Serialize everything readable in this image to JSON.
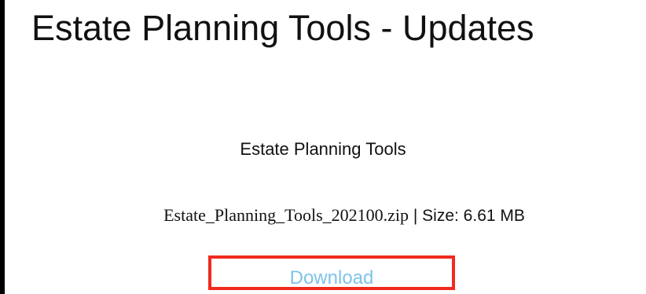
{
  "page": {
    "title": "Estate Planning Tools - Updates"
  },
  "product": {
    "name": "Estate Planning Tools",
    "file_name": "Estate_Planning_Tools_202100.zip",
    "size_text": " | Size: 6.61 MB",
    "download_label": "Download"
  },
  "colors": {
    "highlight_border": "#f02a1e",
    "link": "#7ec3ea",
    "text": "#111111"
  }
}
